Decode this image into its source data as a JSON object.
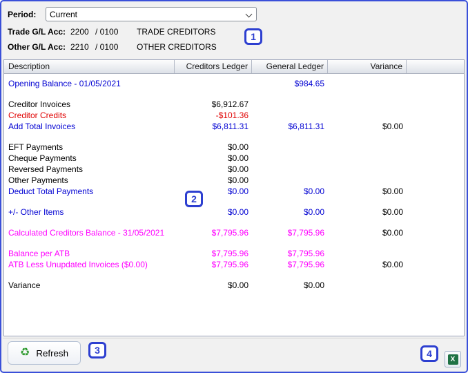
{
  "window": {
    "border_color": "#3a50d9",
    "background": "#f1f1f1"
  },
  "period": {
    "label": "Period:",
    "value": "Current"
  },
  "accounts": [
    {
      "label": "Trade G/L Acc:",
      "code": "2200",
      "branch": "/ 0100",
      "name": "TRADE CREDITORS"
    },
    {
      "label": "Other G/L Acc:",
      "code": "2210",
      "branch": "/ 0100",
      "name": "OTHER CREDITORS"
    }
  ],
  "annotations": [
    {
      "number": "1"
    },
    {
      "number": "2"
    },
    {
      "number": "3"
    },
    {
      "number": "4"
    }
  ],
  "table": {
    "headers": [
      "Description",
      "Creditors Ledger",
      "General Ledger",
      "Variance"
    ],
    "rows": [
      {
        "label": "Opening Balance - 01/05/2021",
        "color": "blue",
        "creditors": "",
        "general": "$984.65",
        "variance": ""
      },
      {
        "spacer": true
      },
      {
        "label": "Creditor Invoices",
        "color": "black",
        "creditors": "$6,912.67",
        "general": "",
        "variance": ""
      },
      {
        "label": "Creditor Credits",
        "color": "red",
        "creditors": "-$101.36",
        "general": "",
        "variance": ""
      },
      {
        "label": "Add Total Invoices",
        "color": "blue",
        "creditors": "$6,811.31",
        "general": "$6,811.31",
        "variance": "$0.00"
      },
      {
        "spacer": true
      },
      {
        "label": "EFT Payments",
        "color": "black",
        "creditors": "$0.00",
        "general": "",
        "variance": ""
      },
      {
        "label": "Cheque Payments",
        "color": "black",
        "creditors": "$0.00",
        "general": "",
        "variance": ""
      },
      {
        "label": "Reversed Payments",
        "color": "black",
        "creditors": "$0.00",
        "general": "",
        "variance": ""
      },
      {
        "label": "Other Payments",
        "color": "black",
        "creditors": "$0.00",
        "general": "",
        "variance": ""
      },
      {
        "label": "Deduct Total Payments",
        "color": "blue",
        "creditors": "$0.00",
        "general": "$0.00",
        "variance": "$0.00"
      },
      {
        "spacer": true
      },
      {
        "label": "+/- Other Items",
        "color": "blue",
        "creditors": "$0.00",
        "general": "$0.00",
        "variance": "$0.00"
      },
      {
        "spacer": true
      },
      {
        "label": "Calculated Creditors Balance - 31/05/2021",
        "color": "magenta",
        "creditors": "$7,795.96",
        "general": "$7,795.96",
        "variance": "$0.00"
      },
      {
        "spacer": true
      },
      {
        "label": "Balance per ATB",
        "color": "magenta",
        "creditors": "$7,795.96",
        "general": "$7,795.96",
        "variance": ""
      },
      {
        "label": "ATB Less Unupdated Invoices ($0.00)",
        "color": "magenta",
        "creditors": "$7,795.96",
        "general": "$7,795.96",
        "variance": "$0.00"
      },
      {
        "spacer": true
      },
      {
        "label": "Variance",
        "color": "black",
        "creditors": "$0.00",
        "general": "$0.00",
        "variance": ""
      }
    ]
  },
  "footer": {
    "refresh_label": "Refresh",
    "refresh_glyph": "♻",
    "excel_glyph": "X"
  },
  "text_colors": {
    "blue": "#0000d2",
    "red": "#e00000",
    "magenta": "#ff00ff",
    "black": "#000000"
  }
}
